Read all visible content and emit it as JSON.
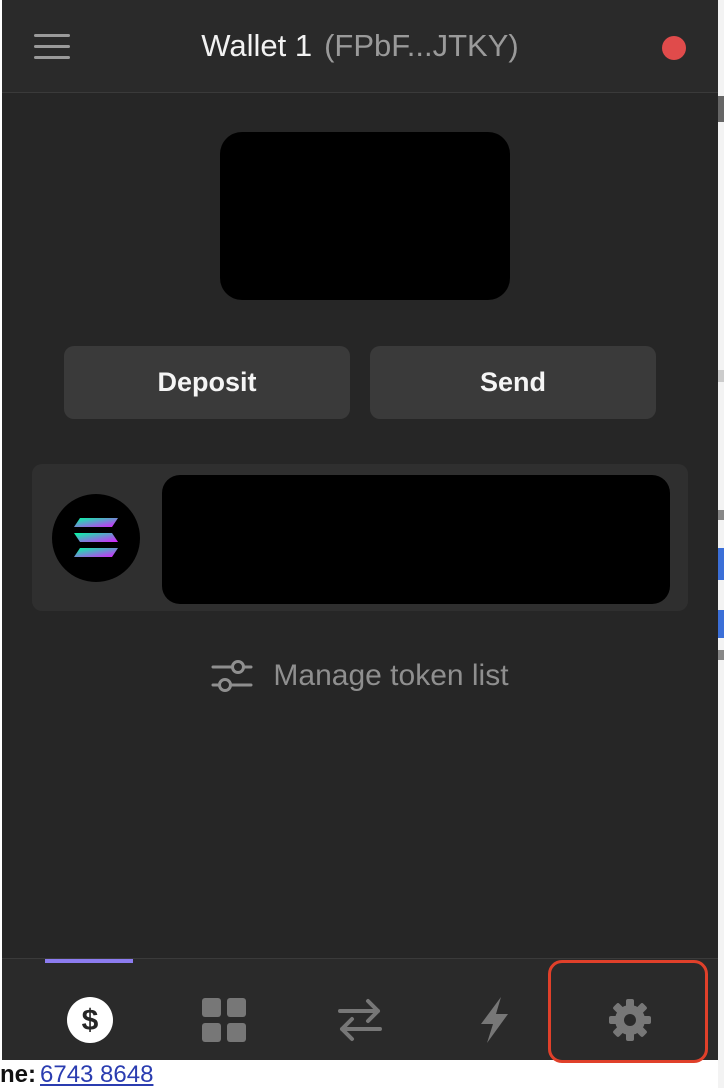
{
  "header": {
    "wallet_name": "Wallet 1",
    "wallet_address": "(FPbF...JTKY)",
    "menu_icon": "hamburger-menu-icon",
    "status_color": "#e04b4b"
  },
  "actions": {
    "deposit_label": "Deposit",
    "send_label": "Send"
  },
  "tokens": [
    {
      "icon": "solana-logo-icon"
    }
  ],
  "manage": {
    "label": "Manage token list",
    "icon": "sliders-icon"
  },
  "tabs": [
    {
      "name": "balances",
      "icon": "dollar-icon",
      "active": true
    },
    {
      "name": "collectibles",
      "icon": "grid-icon",
      "active": false
    },
    {
      "name": "swap",
      "icon": "swap-arrows-icon",
      "active": false
    },
    {
      "name": "activity",
      "icon": "lightning-icon",
      "active": false
    },
    {
      "name": "settings",
      "icon": "gear-icon",
      "active": false,
      "highlighted": true
    }
  ],
  "background_page": {
    "label": "ne:",
    "link": "6743 8648"
  },
  "colors": {
    "accent": "#8c7cf0",
    "highlight": "#e0402a",
    "panel": "#262626"
  }
}
